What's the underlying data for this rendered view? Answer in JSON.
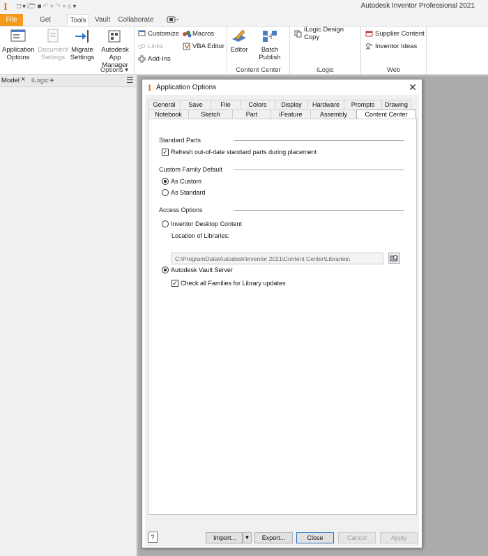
{
  "app": {
    "title": "Autodesk Inventor Professional 2021"
  },
  "ribbon_tabs": [
    "File",
    "Get Started",
    "Tools",
    "Vault",
    "Collaborate"
  ],
  "panels": {
    "options": {
      "title": "Options",
      "application_options": [
        "Application",
        "Options"
      ],
      "document_settings": [
        "Document",
        "Settings"
      ],
      "migrate_settings": [
        "Migrate",
        "Settings"
      ],
      "app_manager": [
        "Autodesk",
        "App Manager"
      ],
      "customize": "Customize",
      "links": "Links",
      "add_ins": "Add-Ins",
      "macros": "Macros",
      "vba_editor": "VBA Editor"
    },
    "content_center": {
      "title": "Content Center",
      "editor": "Editor",
      "batch_publish": "Batch Publish"
    },
    "ilogic": {
      "title": "iLogic",
      "design_copy": "iLogic Design Copy"
    },
    "web": {
      "title": "Web",
      "supplier_content": "Supplier Content",
      "inventor_ideas": "Inventor Ideas"
    }
  },
  "browser": {
    "tab_model": "Model",
    "tab_ilogic": "iLogic"
  },
  "dialog": {
    "title": "Application Options",
    "tabs_row1": [
      "General",
      "Save",
      "File",
      "Colors",
      "Display",
      "Hardware",
      "Prompts",
      "Drawing"
    ],
    "tabs_row2": [
      "Notebook",
      "Sketch",
      "Part",
      "iFeature",
      "Assembly",
      "Content Center"
    ],
    "active_tab": "Content Center",
    "standard_parts": {
      "label": "Standard Parts",
      "refresh_label": "Refresh out-of-date standard parts during placement",
      "refresh_checked": true
    },
    "custom_family": {
      "label": "Custom Family Default",
      "as_custom": "As Custom",
      "as_standard": "As Standard",
      "selected": "As Custom"
    },
    "access": {
      "label": "Access Options",
      "desktop": "Inventor Desktop Content",
      "location_label": "Location of Libraries:",
      "location_value": "C:\\ProgramData\\Autodesk\\Inventor 2021\\Content Center\\Libraries\\",
      "vault": "Autodesk Vault Server",
      "selected": "Autodesk Vault Server",
      "check_all_label": "Check all Families for Library updates",
      "check_all_checked": true
    },
    "buttons": {
      "import": "Import...",
      "export": "Export...",
      "close": "Close",
      "cancel": "Cancel",
      "apply": "Apply",
      "help": "?"
    }
  }
}
